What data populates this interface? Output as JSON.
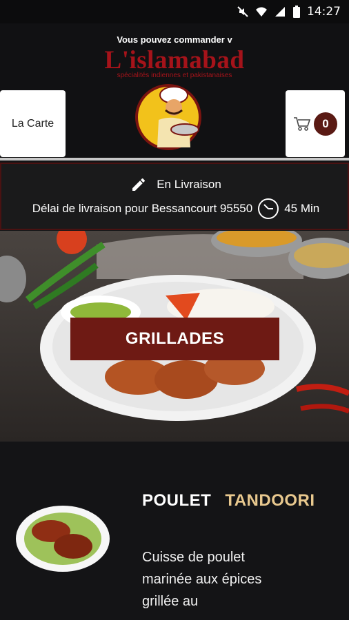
{
  "status_bar": {
    "time": "14:27"
  },
  "header": {
    "marquee": "Vous pouvez commander v",
    "brand_name": "L'islamabad",
    "tagline": "spécialités indiennes et pakistanaises",
    "menu_button": "La Carte",
    "cart_count": "0"
  },
  "delivery": {
    "mode": "En Livraison",
    "delay_text": "Délai de livraison pour Bessancourt 95550",
    "delay_value": "45 Min"
  },
  "hero": {
    "category": "GRILLADES"
  },
  "product": {
    "title_word1": "POULET",
    "title_word2": "TANDOORI",
    "description": "Cuisse de poulet marinée aux épices grillée au"
  },
  "colors": {
    "brand_red": "#a5131a",
    "banner": "#6e1a14",
    "accent_gold": "#e8c88e"
  }
}
